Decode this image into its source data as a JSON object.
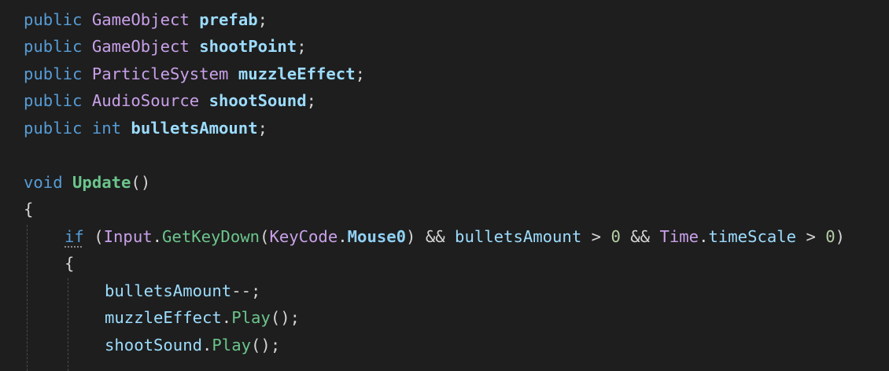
{
  "editor": {
    "theme_colors": {
      "background": "#1e1e1e",
      "keyword": "#569cd6",
      "type": "#c8a0e8",
      "field": "#9cdcfe",
      "method": "#6bc58c",
      "number": "#b5cea8",
      "punctuation": "#d4d4d4"
    },
    "lines": [
      {
        "tokens": [
          {
            "text": "public",
            "kind": "kw"
          },
          {
            "text": " ",
            "kind": "op"
          },
          {
            "text": "GameObject",
            "kind": "ty"
          },
          {
            "text": " ",
            "kind": "op"
          },
          {
            "text": "prefab",
            "kind": "fld"
          },
          {
            "text": ";",
            "kind": "op"
          }
        ]
      },
      {
        "tokens": [
          {
            "text": "public",
            "kind": "kw"
          },
          {
            "text": " ",
            "kind": "op"
          },
          {
            "text": "GameObject",
            "kind": "ty"
          },
          {
            "text": " ",
            "kind": "op"
          },
          {
            "text": "shootPoint",
            "kind": "fld"
          },
          {
            "text": ";",
            "kind": "op"
          }
        ]
      },
      {
        "tokens": [
          {
            "text": "public",
            "kind": "kw"
          },
          {
            "text": " ",
            "kind": "op"
          },
          {
            "text": "ParticleSystem",
            "kind": "ty"
          },
          {
            "text": " ",
            "kind": "op"
          },
          {
            "text": "muzzleEffect",
            "kind": "fld"
          },
          {
            "text": ";",
            "kind": "op"
          }
        ]
      },
      {
        "tokens": [
          {
            "text": "public",
            "kind": "kw"
          },
          {
            "text": " ",
            "kind": "op"
          },
          {
            "text": "AudioSource",
            "kind": "ty"
          },
          {
            "text": " ",
            "kind": "op"
          },
          {
            "text": "shootSound",
            "kind": "fld"
          },
          {
            "text": ";",
            "kind": "op"
          }
        ]
      },
      {
        "tokens": [
          {
            "text": "public",
            "kind": "kw"
          },
          {
            "text": " ",
            "kind": "op"
          },
          {
            "text": "int",
            "kind": "kw"
          },
          {
            "text": " ",
            "kind": "op"
          },
          {
            "text": "bulletsAmount",
            "kind": "fld"
          },
          {
            "text": ";",
            "kind": "op"
          }
        ]
      },
      {
        "tokens": []
      },
      {
        "tokens": [
          {
            "text": "void",
            "kind": "kw"
          },
          {
            "text": " ",
            "kind": "op"
          },
          {
            "text": "Update",
            "kind": "mth-b"
          },
          {
            "text": "()",
            "kind": "op"
          }
        ]
      },
      {
        "tokens": [
          {
            "text": "{",
            "kind": "op"
          }
        ]
      },
      {
        "tokens": [
          {
            "text": "if",
            "kind": "kw squiggle"
          },
          {
            "text": " (",
            "kind": "op"
          },
          {
            "text": "Input",
            "kind": "ty"
          },
          {
            "text": ".",
            "kind": "op"
          },
          {
            "text": "GetKeyDown",
            "kind": "mth"
          },
          {
            "text": "(",
            "kind": "op"
          },
          {
            "text": "KeyCode",
            "kind": "ty"
          },
          {
            "text": ".",
            "kind": "op"
          },
          {
            "text": "Mouse0",
            "kind": "enm"
          },
          {
            "text": ") && ",
            "kind": "op"
          },
          {
            "text": "bulletsAmount",
            "kind": "fld-n"
          },
          {
            "text": " > ",
            "kind": "op"
          },
          {
            "text": "0",
            "kind": "num"
          },
          {
            "text": " && ",
            "kind": "op"
          },
          {
            "text": "Time",
            "kind": "ty"
          },
          {
            "text": ".",
            "kind": "op"
          },
          {
            "text": "timeScale",
            "kind": "fld-n"
          },
          {
            "text": " > ",
            "kind": "op"
          },
          {
            "text": "0",
            "kind": "num"
          },
          {
            "text": ")",
            "kind": "op"
          }
        ]
      },
      {
        "tokens": [
          {
            "text": "{",
            "kind": "op"
          }
        ]
      },
      {
        "tokens": [
          {
            "text": "bulletsAmount",
            "kind": "fld-n"
          },
          {
            "text": "--;",
            "kind": "op"
          }
        ]
      },
      {
        "tokens": [
          {
            "text": "muzzleEffect",
            "kind": "fld-n"
          },
          {
            "text": ".",
            "kind": "op"
          },
          {
            "text": "Play",
            "kind": "mth"
          },
          {
            "text": "();",
            "kind": "op"
          }
        ]
      },
      {
        "tokens": [
          {
            "text": "shootSound",
            "kind": "fld-n"
          },
          {
            "text": ".",
            "kind": "op"
          },
          {
            "text": "Play",
            "kind": "mth"
          },
          {
            "text": "();",
            "kind": "op"
          }
        ]
      }
    ]
  }
}
